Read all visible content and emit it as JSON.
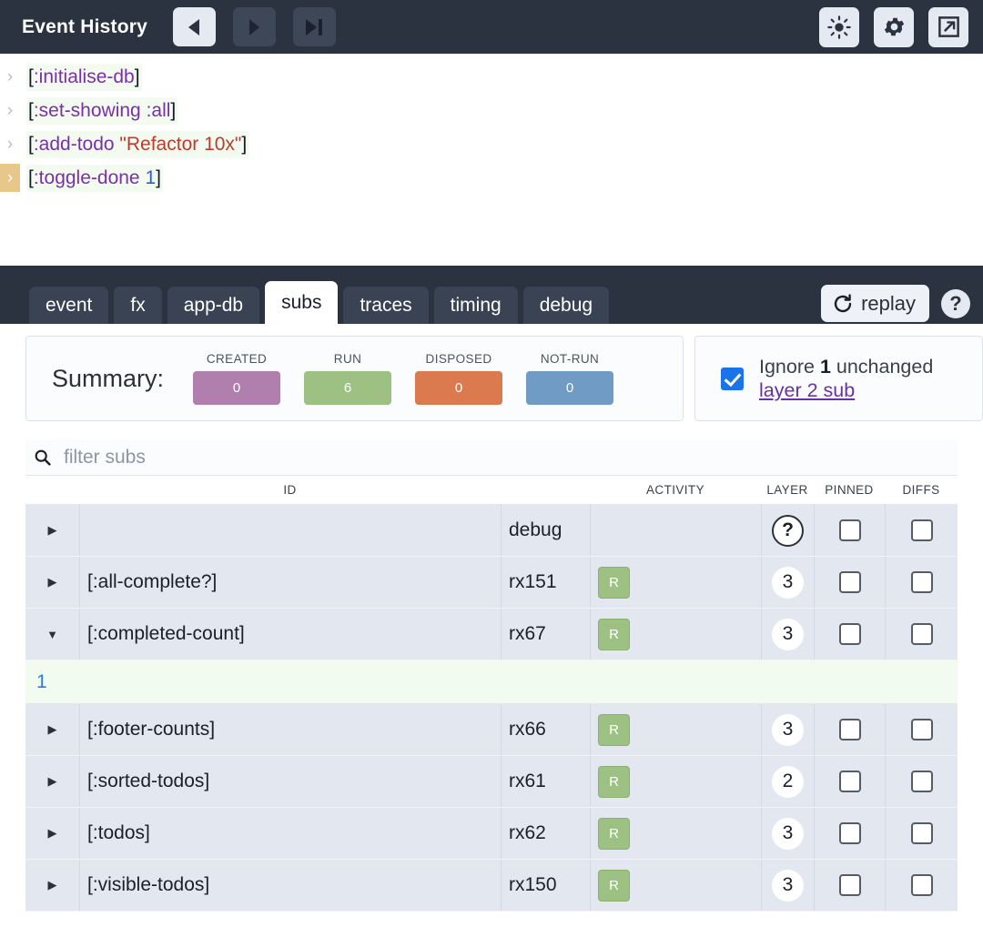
{
  "epoch_header": {
    "title": "Event History",
    "nav": [
      {
        "name": "previous-epoch-button",
        "icon": "triangle-left-icon",
        "state": "active"
      },
      {
        "name": "next-epoch-button",
        "icon": "triangle-right-icon",
        "state": "disabled"
      },
      {
        "name": "skip-to-latest-button",
        "icon": "skip-forward-icon",
        "state": "enabled"
      }
    ],
    "actions": [
      {
        "name": "brightness-button",
        "icon": "sun-icon"
      },
      {
        "name": "settings-button",
        "icon": "gear-icon"
      },
      {
        "name": "pop-out-button",
        "icon": "external-link-icon"
      }
    ]
  },
  "events": [
    {
      "selected": false,
      "parts": [
        {
          "text": "[",
          "kind": "brk"
        },
        {
          "text": ":initialise-db",
          "kind": "kw"
        },
        {
          "text": "]",
          "kind": "brk"
        }
      ]
    },
    {
      "selected": false,
      "parts": [
        {
          "text": "[",
          "kind": "brk"
        },
        {
          "text": ":set-showing :all",
          "kind": "kw"
        },
        {
          "text": "]",
          "kind": "brk"
        }
      ]
    },
    {
      "selected": false,
      "parts": [
        {
          "text": "[",
          "kind": "brk"
        },
        {
          "text": ":add-todo ",
          "kind": "kw"
        },
        {
          "text": "\"Refactor 10x\"",
          "kind": "str"
        },
        {
          "text": "]",
          "kind": "brk"
        }
      ]
    },
    {
      "selected": true,
      "parts": [
        {
          "text": "[",
          "kind": "brk"
        },
        {
          "text": ":toggle-done ",
          "kind": "kw"
        },
        {
          "text": "1",
          "kind": "num"
        },
        {
          "text": "]",
          "kind": "brk"
        }
      ]
    }
  ],
  "tabs": [
    {
      "label": "event",
      "active": false
    },
    {
      "label": "fx",
      "active": false
    },
    {
      "label": "app-db",
      "active": false
    },
    {
      "label": "subs",
      "active": true
    },
    {
      "label": "traces",
      "active": false
    },
    {
      "label": "timing",
      "active": false
    },
    {
      "label": "debug",
      "active": false
    }
  ],
  "toolbar": {
    "replay_label": "replay",
    "help_label": "?"
  },
  "summary": {
    "label": "Summary:",
    "metrics": [
      {
        "label": "CREATED",
        "value": "0",
        "color": "#b07fae"
      },
      {
        "label": "RUN",
        "value": "6",
        "color": "#9dc183"
      },
      {
        "label": "DISPOSED",
        "value": "0",
        "color": "#db7a4e"
      },
      {
        "label": "NOT-RUN",
        "value": "0",
        "color": "#6f9bc4"
      }
    ]
  },
  "ignore_panel": {
    "checked": true,
    "prefix": "Ignore ",
    "count": "1",
    "suffix": " unchanged",
    "link": "layer 2 sub"
  },
  "filter": {
    "placeholder": "filter subs",
    "value": "",
    "icon": "search-icon"
  },
  "table": {
    "columns": [
      "",
      "ID",
      "",
      "ACTIVITY",
      "LAYER",
      "PINNED",
      "DIFFS"
    ],
    "headers": {
      "id": "ID",
      "activity": "ACTIVITY",
      "layer": "LAYER",
      "pinned": "PINNED",
      "diffs": "DIFFS"
    },
    "rows": [
      {
        "expander": "collapsed",
        "id": "",
        "rx": "debug",
        "activity": "",
        "layer": "?",
        "layer_unknown": true,
        "pinned": false,
        "diffs": false
      },
      {
        "expander": "collapsed",
        "id": "[:all-complete?]",
        "rx": "rx151",
        "activity": "R",
        "layer": "3",
        "layer_unknown": false,
        "pinned": false,
        "diffs": false
      },
      {
        "expander": "expanded",
        "id": "[:completed-count]",
        "rx": "rx67",
        "activity": "R",
        "layer": "3",
        "layer_unknown": false,
        "pinned": false,
        "diffs": false,
        "expanded_value": "1"
      },
      {
        "expander": "collapsed",
        "id": "[:footer-counts]",
        "rx": "rx66",
        "activity": "R",
        "layer": "3",
        "layer_unknown": false,
        "pinned": false,
        "diffs": false
      },
      {
        "expander": "collapsed",
        "id": "[:sorted-todos]",
        "rx": "rx61",
        "activity": "R",
        "layer": "2",
        "layer_unknown": false,
        "pinned": false,
        "diffs": false
      },
      {
        "expander": "collapsed",
        "id": "[:todos]",
        "rx": "rx62",
        "activity": "R",
        "layer": "3",
        "layer_unknown": false,
        "pinned": false,
        "diffs": false
      },
      {
        "expander": "collapsed",
        "id": "[:visible-todos]",
        "rx": "rx150",
        "activity": "R",
        "layer": "3",
        "layer_unknown": false,
        "pinned": false,
        "diffs": false
      }
    ]
  },
  "colors": {
    "header_bg": "#2c3340",
    "tab_inactive": "#3a4354",
    "row_bg": "#e2e7f0",
    "expanded_bg": "#f2fbef",
    "accent_checkbox": "#1a73e8",
    "link": "#6b2fa8",
    "selected_event": "#e8c88a"
  }
}
